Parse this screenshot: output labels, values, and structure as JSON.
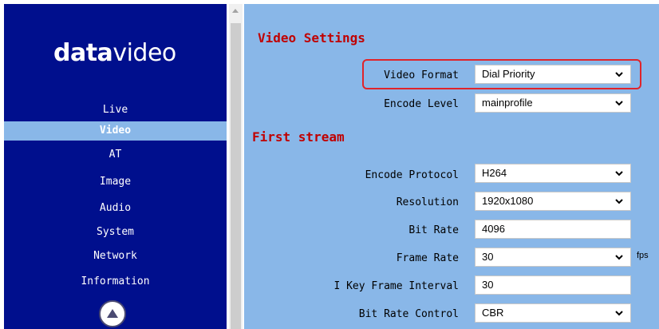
{
  "sidebar": {
    "logo_bold": "data",
    "logo_light": "video",
    "items": [
      {
        "label": "Live"
      },
      {
        "label": "Video"
      },
      {
        "label": "AT"
      },
      {
        "label": "Image"
      },
      {
        "label": "Audio"
      },
      {
        "label": "System"
      },
      {
        "label": "Network"
      },
      {
        "label": "Information"
      }
    ],
    "active_item": "Video"
  },
  "video_settings": {
    "title": "Video Settings",
    "video_format_label": "Video Format",
    "video_format_value": "Dial Priority",
    "encode_level_label": "Encode Level",
    "encode_level_value": "mainprofile"
  },
  "first_stream": {
    "title": "First stream",
    "encode_protocol_label": "Encode Protocol",
    "encode_protocol_value": "H264",
    "resolution_label": "Resolution",
    "resolution_value": "1920x1080",
    "bit_rate_label": "Bit Rate",
    "bit_rate_value": "4096",
    "frame_rate_label": "Frame Rate",
    "frame_rate_value": "30",
    "frame_rate_unit": "fps",
    "key_frame_label": "I Key Frame Interval",
    "key_frame_value": "30",
    "bit_rate_control_label": "Bit Rate Control",
    "bit_rate_control_value": "CBR"
  },
  "colors": {
    "sidebar_bg": "#000f8d",
    "main_bg": "#89b7e8",
    "section_title": "#c00000",
    "highlight_border": "#e0242a"
  },
  "icons": {
    "scroll_top": "up-arrow-circle-icon",
    "select_chevron": "chevron-down-icon"
  }
}
